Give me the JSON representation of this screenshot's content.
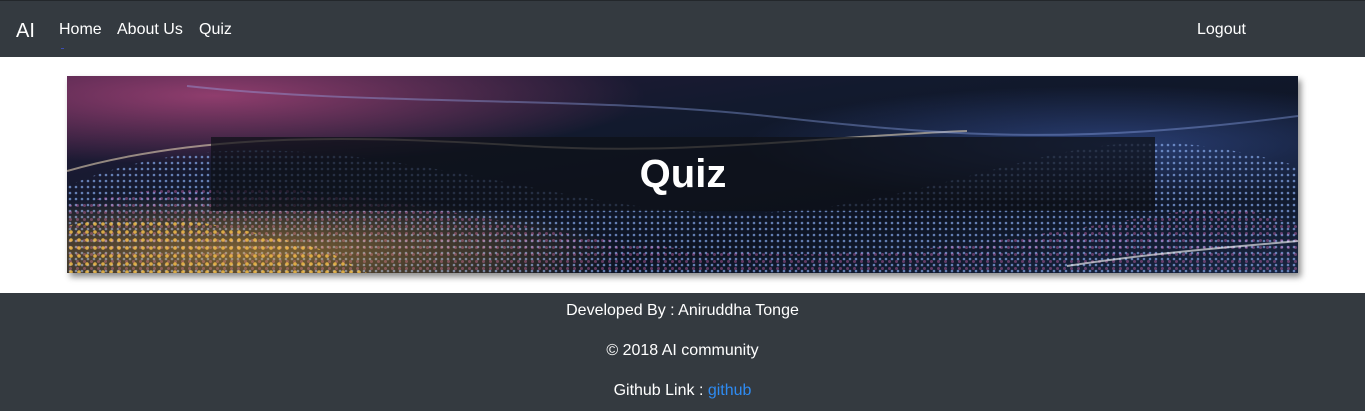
{
  "navbar": {
    "brand": "AI",
    "links": [
      {
        "label": "Home"
      },
      {
        "label": "About Us"
      },
      {
        "label": "Quiz"
      }
    ],
    "logout_label": "Logout",
    "background": "#343a40"
  },
  "hero": {
    "title": "Quiz"
  },
  "footer": {
    "developed_by": "Developed By : Aniruddha Tonge",
    "copyright": "© 2018 AI community",
    "github_prefix": "Github Link : ",
    "github_link_text": "github",
    "link_color": "#2e8bf2",
    "background": "#343a40"
  }
}
